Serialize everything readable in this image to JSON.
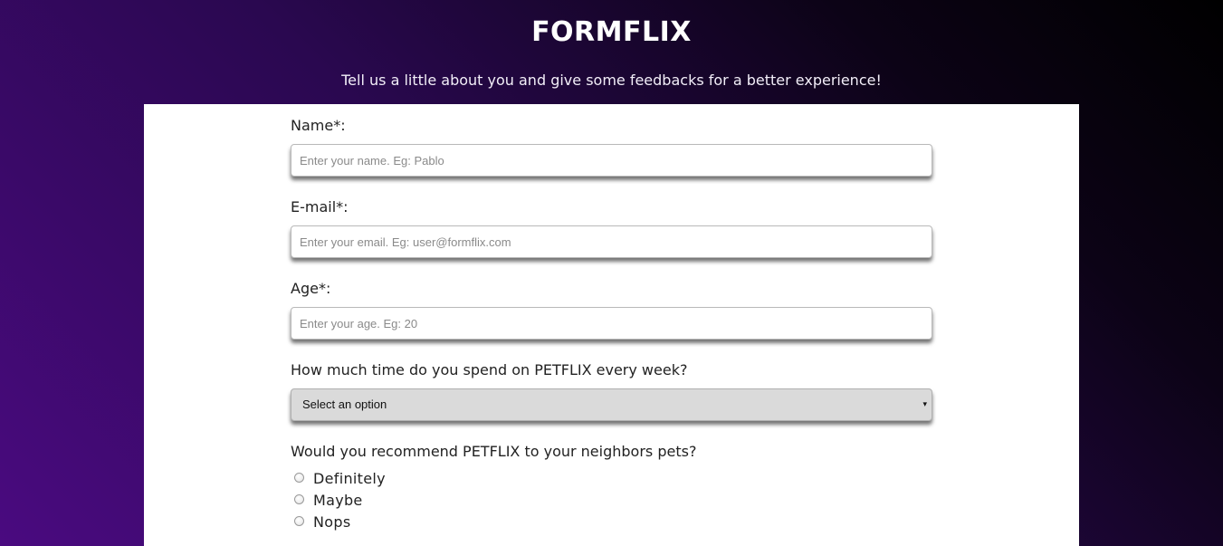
{
  "header": {
    "brand": "FORMFLIX",
    "subtitle": "Tell us a little about you and give some feedbacks for a better experience!"
  },
  "form": {
    "name": {
      "label": "Name*:",
      "placeholder": "Enter your name. Eg: Pablo",
      "value": ""
    },
    "email": {
      "label": "E-mail*:",
      "placeholder": "Enter your email. Eg: user@formflix.com",
      "value": ""
    },
    "age": {
      "label": "Age*:",
      "placeholder": "Enter your age. Eg: 20",
      "value": ""
    },
    "time_spent": {
      "label": "How much time do you spend on PETFLIX every week?",
      "selected": "Select an option",
      "arrow": "▾"
    },
    "recommend": {
      "label": "Would you recommend PETFLIX to your neighbors pets?",
      "options": [
        {
          "label": "Definitely",
          "checked": false
        },
        {
          "label": "Maybe",
          "checked": false
        },
        {
          "label": "Nops",
          "checked": false
        }
      ]
    }
  },
  "colors": {
    "gradient_dark": "#000000",
    "gradient_purple": "#4a0a80",
    "card_background": "#ffffff",
    "select_background": "#dadada"
  }
}
